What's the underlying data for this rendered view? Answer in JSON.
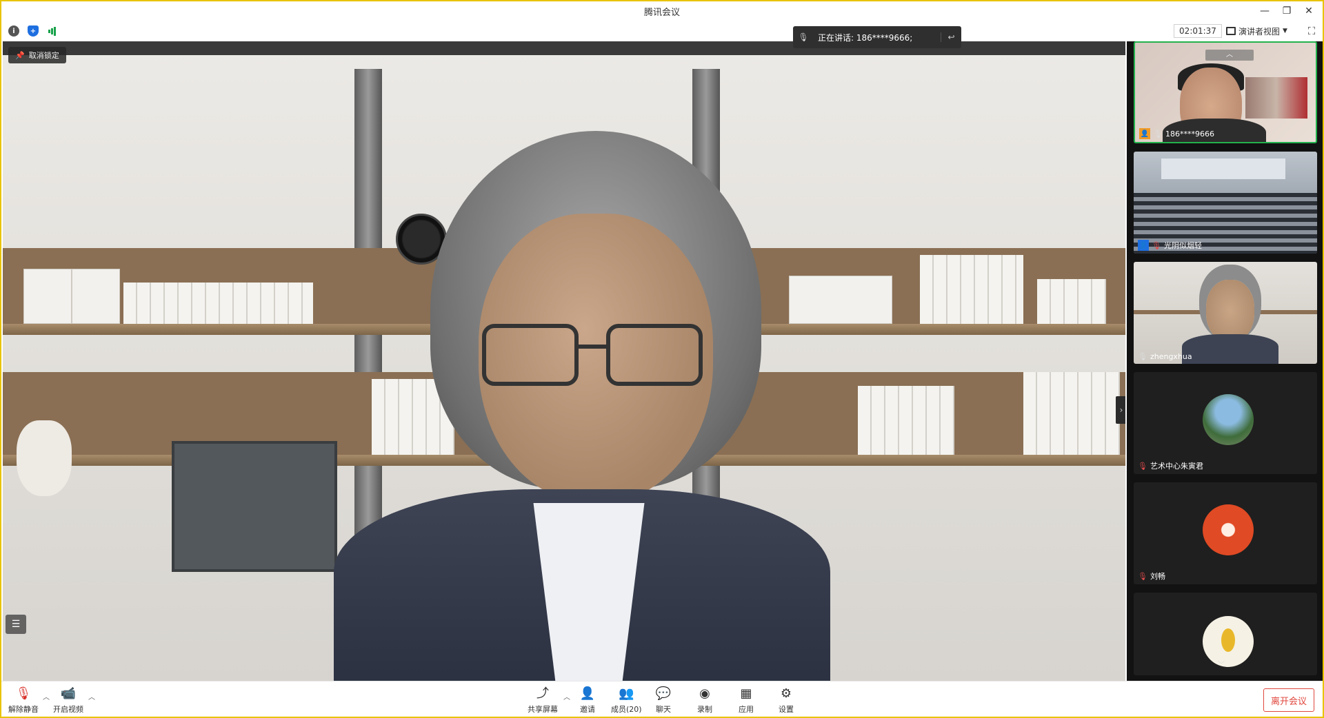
{
  "window": {
    "title": "腾讯会议"
  },
  "toolbar": {
    "timer": "02:01:37",
    "view_label": "演讲者视图"
  },
  "speaking": {
    "label": "正在讲话: 186****9666;"
  },
  "main": {
    "unpin_label": "取消锁定"
  },
  "participants": [
    {
      "name": "186****9666"
    },
    {
      "name": "光阴似烟轻"
    },
    {
      "name": "zhengxhua"
    },
    {
      "name": "艺术中心朱寅君"
    },
    {
      "name": "刘畅"
    }
  ],
  "bottom": {
    "mute_label": "解除静音",
    "video_label": "开启视频",
    "share_label": "共享屏幕",
    "invite_label": "邀请",
    "members_label": "成员(20)",
    "chat_label": "聊天",
    "record_label": "录制",
    "apps_label": "应用",
    "settings_label": "设置",
    "leave_label": "离开会议"
  },
  "colors": {
    "accent_green": "#22b24c",
    "leave_red": "#e0463c",
    "window_border": "#e8c400"
  }
}
